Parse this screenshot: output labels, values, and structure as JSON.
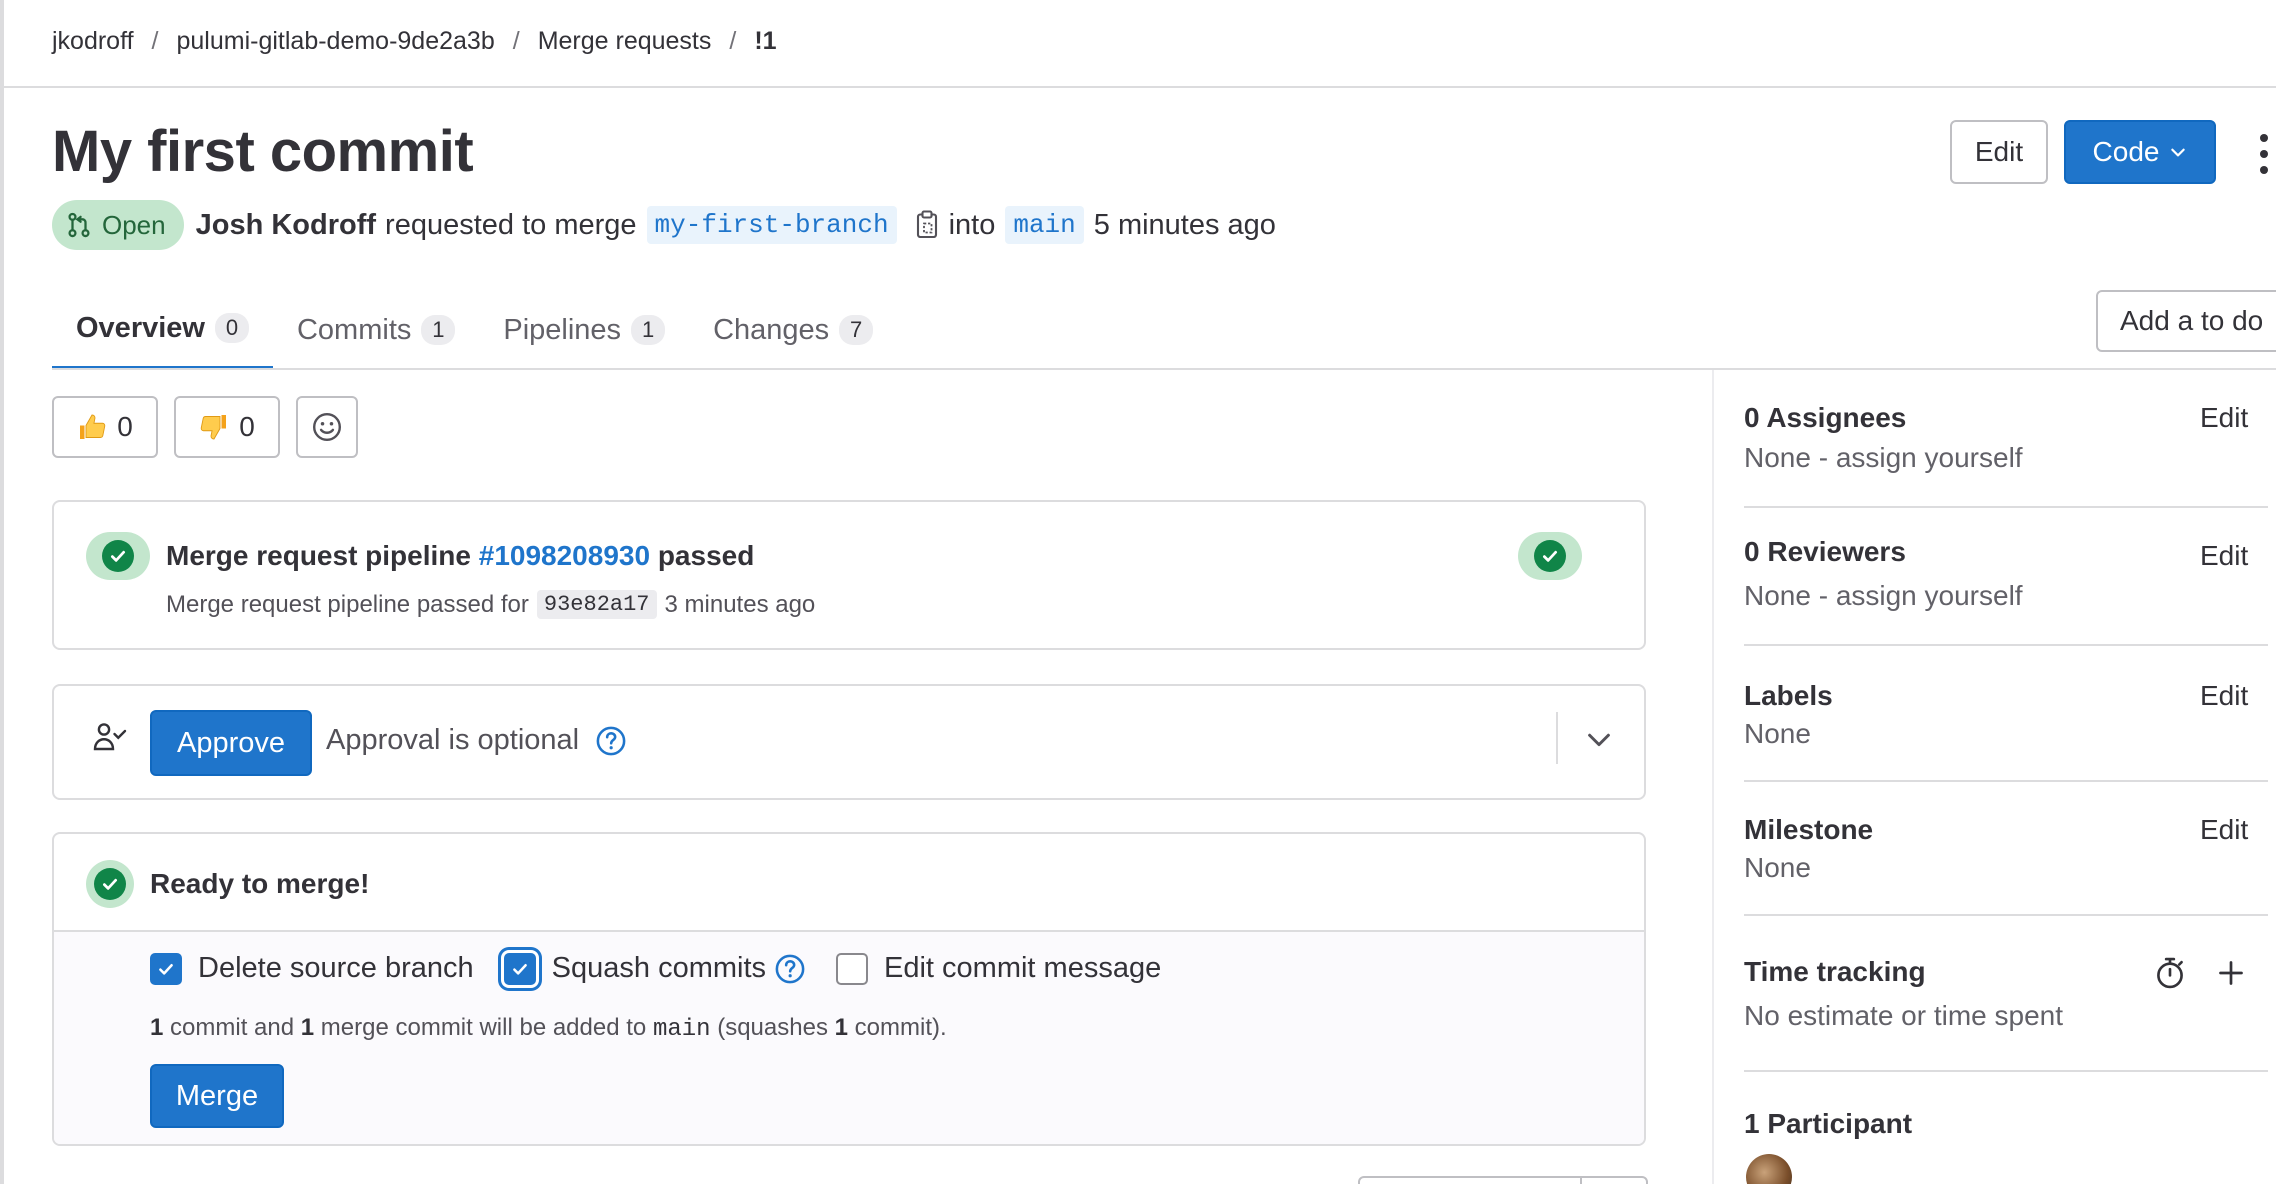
{
  "breadcrumb": {
    "items": [
      "jkodroff",
      "pulumi-gitlab-demo-9de2a3b",
      "Merge requests",
      "!1"
    ],
    "separator": "/"
  },
  "header": {
    "title": "My first commit",
    "edit_label": "Edit",
    "code_label": "Code"
  },
  "meta": {
    "status": "Open",
    "author": "Josh Kodroff",
    "requested_text": "requested to merge",
    "source_branch": "my-first-branch",
    "into_text": "into",
    "target_branch": "main",
    "time": "5 minutes ago"
  },
  "tabs": [
    {
      "label": "Overview",
      "count": "0",
      "active": true
    },
    {
      "label": "Commits",
      "count": "1",
      "active": false
    },
    {
      "label": "Pipelines",
      "count": "1",
      "active": false
    },
    {
      "label": "Changes",
      "count": "7",
      "active": false
    }
  ],
  "todo_label": "Add a to do",
  "awards": {
    "thumbs_up": "0",
    "thumbs_down": "0"
  },
  "pipeline": {
    "title_prefix": "Merge request pipeline",
    "pipeline_id": "#1098208930",
    "title_suffix": "passed",
    "sub_prefix": "Merge request pipeline passed for",
    "sha": "93e82a17",
    "sub_time": "3 minutes ago"
  },
  "approval": {
    "button_label": "Approve",
    "text": "Approval is optional"
  },
  "merge": {
    "status": "Ready to merge!",
    "delete_source": "Delete source branch",
    "squash": "Squash commits",
    "edit_message": "Edit commit message",
    "info_count1": "1",
    "info_text1": "commit and",
    "info_count2": "1",
    "info_text2": "merge commit will be added to",
    "info_branch": "main",
    "info_text3": "(squashes",
    "info_count3": "1",
    "info_text4": "commit).",
    "button_label": "Merge"
  },
  "sidebar": {
    "assignees": {
      "title": "0 Assignees",
      "value": "None - assign yourself",
      "edit": "Edit"
    },
    "reviewers": {
      "title": "0 Reviewers",
      "value": "None - assign yourself",
      "edit": "Edit"
    },
    "labels": {
      "title": "Labels",
      "value": "None",
      "edit": "Edit"
    },
    "milestone": {
      "title": "Milestone",
      "value": "None",
      "edit": "Edit"
    },
    "time_tracking": {
      "title": "Time tracking",
      "value": "No estimate or time spent"
    },
    "participants": {
      "title": "1 Participant"
    }
  },
  "colors": {
    "brand_blue": "#1f75cb",
    "success_green": "#108548",
    "success_bg": "#c3e6cd"
  }
}
